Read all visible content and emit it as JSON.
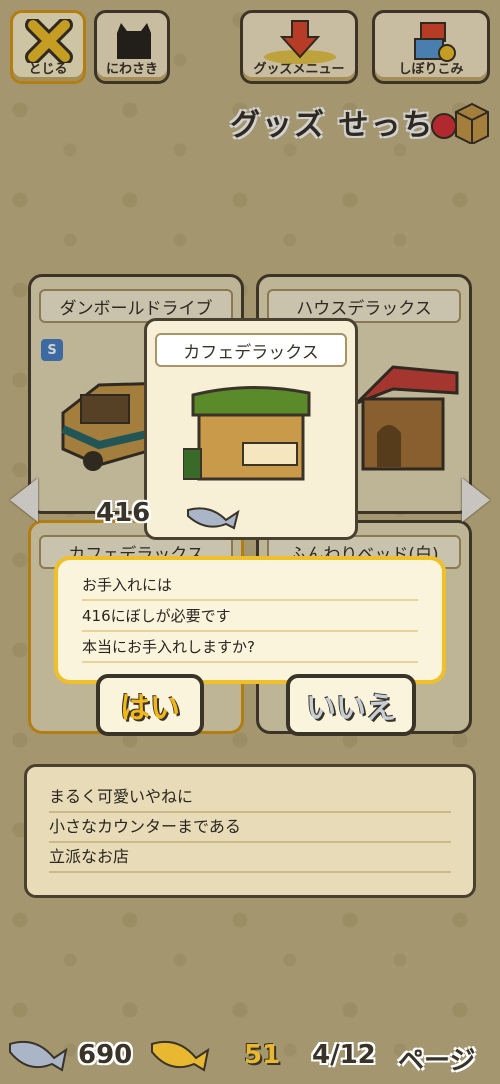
{
  "buttons": {
    "close": "とじる",
    "garden": "にわさき",
    "goods_menu": "グッズメニュー",
    "filter": "しぼりこみ"
  },
  "title": "グッズ せっち",
  "cards": {
    "top_left": "ダンボールドライブ",
    "top_right": "ハウスデラックス",
    "bottom_left": "カフェデラックス",
    "bottom_right": "ふんわりベッド(白)",
    "badge": "S"
  },
  "popup": {
    "name": "カフェデラックス",
    "cost": "416"
  },
  "confirm": {
    "line1": "お手入れには",
    "line2": "416にぼしが必要です",
    "line3": "本当にお手入れしますか?",
    "yes": "はい",
    "no": "いいえ"
  },
  "description": {
    "line1": "まるく可愛いやねに",
    "line2": "小さなカウンターまである",
    "line3": "立派なお店"
  },
  "footer": {
    "silver_fish": "690",
    "gold_fish": "51",
    "page": "4/12",
    "page_label": "ページ"
  }
}
